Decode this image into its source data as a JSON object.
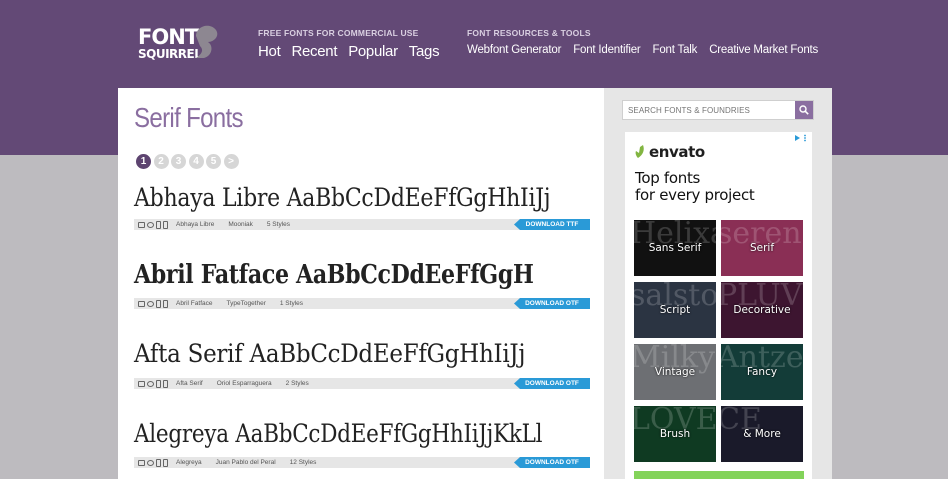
{
  "logo": {
    "line1": "FONT",
    "line2": "SQUIRREL"
  },
  "nav": {
    "free_caption": "FREE FONTS FOR COMMERCIAL USE",
    "free_links": [
      "Hot",
      "Recent",
      "Popular",
      "Tags"
    ],
    "resources_caption": "FONT RESOURCES & TOOLS",
    "resources_links": [
      "Webfont Generator",
      "Font Identifier",
      "Font Talk",
      "Creative Market Fonts"
    ]
  },
  "main": {
    "title": "Serif Fonts",
    "pages": [
      "1",
      "2",
      "3",
      "4",
      "5",
      ">"
    ],
    "fonts": [
      {
        "sample": "Abhaya Libre AaBbCcDdEeFfGgHhIiJj",
        "name": "Abhaya Libre",
        "foundry": "Mooniak",
        "styles": "5 Styles",
        "download": "DOWNLOAD TTF"
      },
      {
        "sample": "Abril Fatface AaBbCcDdEeFfGgH",
        "name": "Abril Fatface",
        "foundry": "TypeTogether",
        "styles": "1 Styles",
        "download": "DOWNLOAD OTF"
      },
      {
        "sample": "Afta Serif AaBbCcDdEeFfGgHhIiJj",
        "name": "Afta Serif",
        "foundry": "Oriol Esparraguera",
        "styles": "2 Styles",
        "download": "DOWNLOAD OTF"
      },
      {
        "sample": "Alegreya AaBbCcDdEeFfGgHhIiJjKkLl",
        "name": "Alegreya",
        "foundry": "Juan Pablo del Peral",
        "styles": "12 Styles",
        "download": "DOWNLOAD OTF"
      }
    ]
  },
  "sidebar": {
    "search_placeholder": "SEARCH FONTS & FOUNDRIES",
    "ad": {
      "brand": "envato",
      "headline_1": "Top fonts",
      "headline_2": "for every project",
      "tiles": [
        {
          "label": "Sans Serif",
          "bg": "Helixa",
          "color": "#111111"
        },
        {
          "label": "Serif",
          "bg": "seren",
          "color": "#8a2f55"
        },
        {
          "label": "Script",
          "bg": "salston",
          "color": "#2b3442"
        },
        {
          "label": "Decorative",
          "bg": "PLUVE",
          "color": "#3d1530"
        },
        {
          "label": "Vintage",
          "bg": "Milky",
          "color": "#6d6f73"
        },
        {
          "label": "Fancy",
          "bg": "Antze",
          "color": "#133c38"
        },
        {
          "label": "Brush",
          "bg": "LOVE",
          "color": "#0f3a22"
        },
        {
          "label": "& More",
          "bg": "CE",
          "color": "#1a1a2a"
        }
      ]
    }
  },
  "colors": {
    "header": "#634976",
    "accent": "#8a6ea0",
    "download": "#2a9ad7",
    "background": "#bdbbbf"
  }
}
